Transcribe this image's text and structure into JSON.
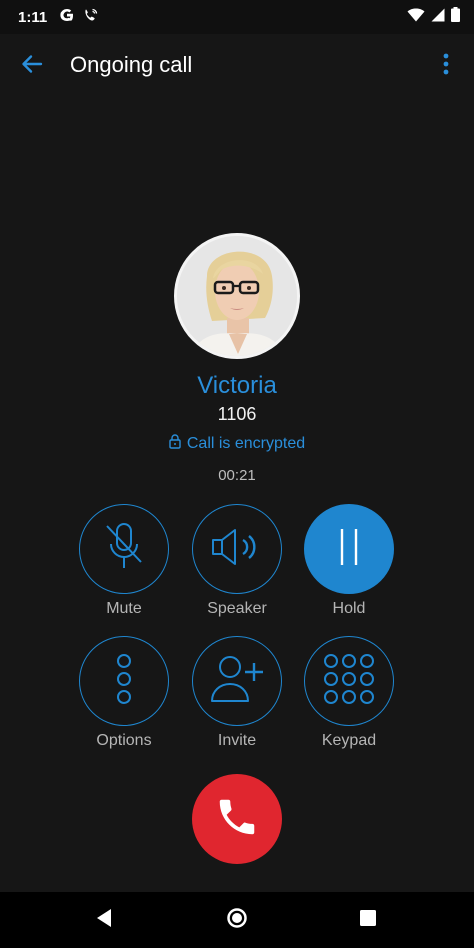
{
  "status_bar": {
    "time": "1:11",
    "icons": [
      "google-g-icon",
      "wifi-calling-icon",
      "wifi-icon",
      "signal-icon",
      "battery-icon"
    ]
  },
  "app_bar": {
    "title": "Ongoing call",
    "back_icon": "back-arrow-icon",
    "menu_icon": "overflow-menu-icon"
  },
  "caller": {
    "name": "Victoria",
    "number": "1106",
    "encryption": "Call is encrypted",
    "duration": "00:21"
  },
  "controls": [
    {
      "label": "Mute",
      "icon": "microphone-off-icon"
    },
    {
      "label": "Speaker",
      "icon": "speaker-icon"
    },
    {
      "label": "Hold",
      "icon": "pause-icon",
      "active": true
    },
    {
      "label": "Options",
      "icon": "vertical-dots-icon"
    },
    {
      "label": "Invite",
      "icon": "add-person-icon"
    },
    {
      "label": "Keypad",
      "icon": "keypad-icon"
    }
  ],
  "hangup": {
    "icon": "hangup-phone-icon"
  },
  "nav_bar": {
    "icons": [
      "nav-back-icon",
      "nav-home-icon",
      "nav-recents-icon"
    ]
  },
  "colors": {
    "background": "#161616",
    "accent": "#1f86cf",
    "hangup": "#e0262f",
    "label": "#b5b5b5"
  }
}
